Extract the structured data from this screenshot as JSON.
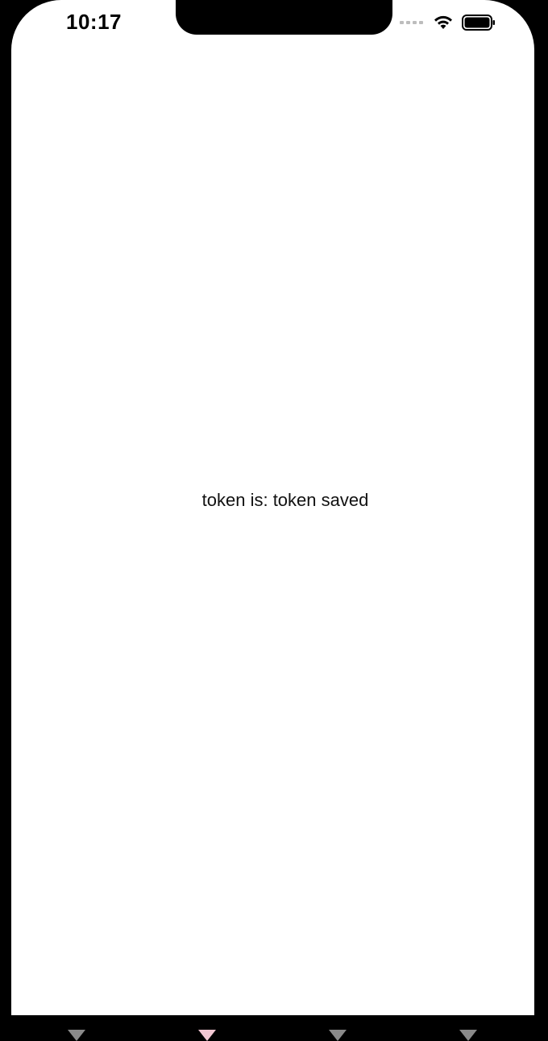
{
  "status_bar": {
    "time": "10:17",
    "signal_icon": "signal-icon",
    "wifi_icon": "wifi-icon",
    "battery_icon": "battery-icon"
  },
  "main": {
    "message": "token is: token saved"
  },
  "tab_bar": {
    "markers": [
      {
        "name": "tab-1",
        "color": "#8a8a8a",
        "active": false
      },
      {
        "name": "tab-2",
        "color": "#f2c7d3",
        "active": true
      },
      {
        "name": "tab-3",
        "color": "#8a8a8a",
        "active": false
      },
      {
        "name": "tab-4",
        "color": "#8a8a8a",
        "active": false
      }
    ]
  },
  "colors": {
    "background": "#ffffff",
    "frame": "#000000",
    "text": "#111111",
    "active_tab": "#f2c7d3",
    "inactive_tab": "#8a8a8a"
  }
}
